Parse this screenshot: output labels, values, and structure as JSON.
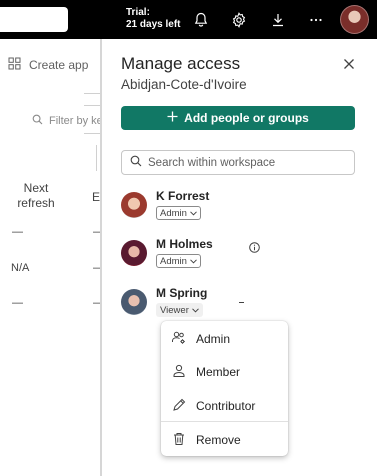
{
  "topbar": {
    "trial_label": "Trial:",
    "trial_days": "21 days left"
  },
  "background": {
    "create_app": "Create app",
    "filter_placeholder": "Filter by ke",
    "column_next_refresh_line1": "Next",
    "column_next_refresh_line2": "refresh",
    "column_truncated": "En",
    "rows": [
      "—",
      "N/A",
      "—"
    ]
  },
  "panel": {
    "title": "Manage access",
    "subtitle": "Abidjan-Cote-d'Ivoire",
    "add_button": "Add people or groups",
    "search_placeholder": "Search within workspace",
    "people": [
      {
        "name": "K Forrest",
        "role": "Admin"
      },
      {
        "name": "M Holmes",
        "role": "Admin"
      },
      {
        "name": "M Spring",
        "role": "Viewer"
      }
    ]
  },
  "role_menu": {
    "items": [
      "Admin",
      "Member",
      "Contributor",
      "Remove"
    ]
  },
  "colors": {
    "primary": "#117865",
    "topbar": "#000000"
  }
}
